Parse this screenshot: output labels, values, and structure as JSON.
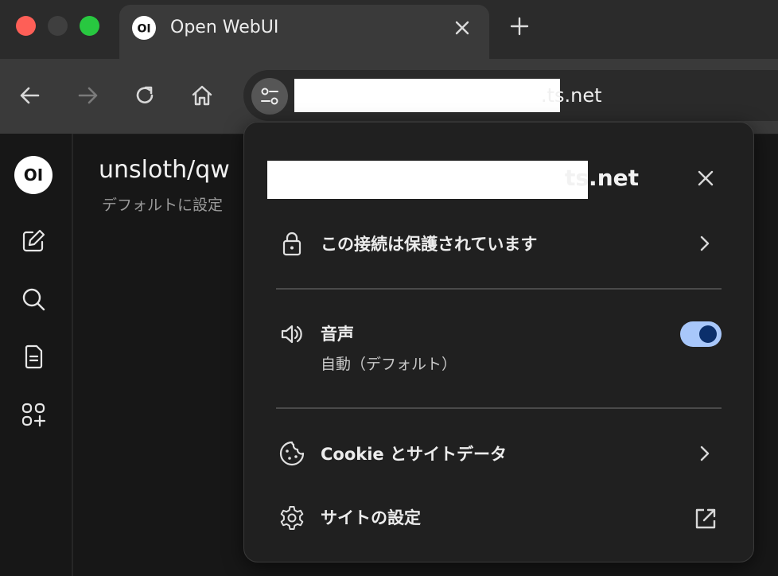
{
  "browser": {
    "tab": {
      "title": "Open WebUI",
      "favicon_text": "OI"
    },
    "new_tab_icon": "plus-icon",
    "url_suffix": ".ts.net",
    "colors": {
      "tab_bg": "#3a3a3a",
      "toolbar_bg": "#3a3a3a",
      "strip_bg": "#2b2b2b"
    }
  },
  "app": {
    "logo_text": "OI",
    "model_title": "unsloth/qw",
    "model_subtitle": "デフォルトに設定"
  },
  "popup": {
    "host_suffix": "ts.net",
    "connection_label": "この接続は保護されています",
    "sound_label": "音声",
    "sound_value": "自動（デフォルト）",
    "sound_enabled": true,
    "cookies_label": "Cookie とサイトデータ",
    "site_settings_label": "サイトの設定",
    "colors": {
      "toggle_track": "#a8c7fa",
      "toggle_knob": "#0b2f6b"
    }
  }
}
